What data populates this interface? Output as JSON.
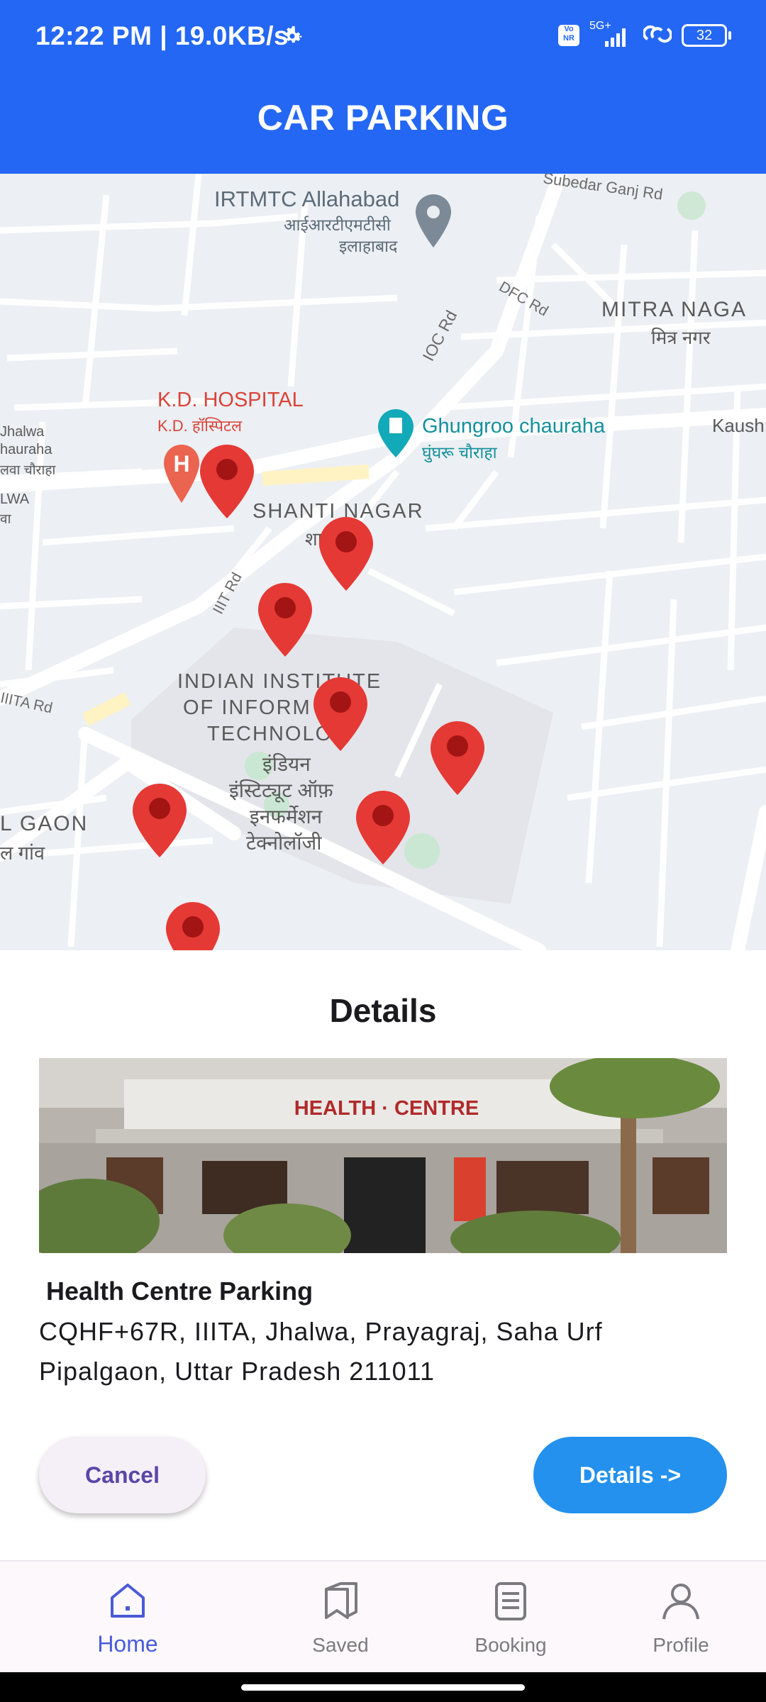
{
  "status_bar": {
    "time_speed": "12:22 PM | 19.0KB/s",
    "network": "5G+",
    "volte": "Vo NR",
    "battery": "32"
  },
  "app_bar": {
    "title": "CAR PARKING"
  },
  "map": {
    "labels": {
      "irtmtc_en": "IRTMTC Allahabad",
      "irtmtc_hi1": "आईआरटीएमटीसी",
      "irtmtc_hi2": "इलाहाबाद",
      "subedar": "Subedar Ganj Rd",
      "dfc": "DFC Rd",
      "ioc": "IOC Rd",
      "mitra_en": "MITRA NAGA",
      "mitra_hi": "मित्र नगर",
      "kaush": "Kaush",
      "kd_en": "K.D. HOSPITAL",
      "kd_hi": "K.D. हॉस्पिटल",
      "ghungroo_en": "Ghungroo chauraha",
      "ghungroo_hi": "घुंघरू चौराहा",
      "jhalwa1": "Jhalwa",
      "jhalwa2": "hauraha",
      "jhalwa3": "लवा चौराहा",
      "lwa1": "LWA",
      "lwa2": "वा",
      "shanti_en": "SHANTI NAGAR",
      "shanti_hi": "शा   गर",
      "iiit_rd": "IIIT Rd",
      "iiita_rd": "IIITA Rd",
      "inst1": "INDIAN INSTITUTE",
      "inst2": "OF INFORM    ON",
      "inst3": "TECHNOLO  Y",
      "inst_hi1": "इंडियन",
      "inst_hi2": "इंस्टिट्यूट ऑफ़",
      "inst_hi3": "इनफर्मेशन",
      "inst_hi4": "टेक्नोलॉजी",
      "gaon_en": "L GAON",
      "gaon_hi": "ल गांव"
    },
    "colors": {
      "marker": "#e53935",
      "marker_center": "#a31515",
      "road": "#ffffff"
    }
  },
  "details": {
    "title": "Details",
    "photo_sign": "HEALTH · CENTRE",
    "place_name": "Health Centre Parking",
    "address": "CQHF+67R, IIITA, Jhalwa, Prayagraj, Saha Urf Pipalgaon, Uttar Pradesh 211011",
    "cancel_label": "Cancel",
    "details_label": "Details ->"
  },
  "bottom_nav": {
    "items": [
      {
        "label": "Home",
        "icon": "home-icon",
        "active": true
      },
      {
        "label": "Saved",
        "icon": "saved-icon",
        "active": false
      },
      {
        "label": "Booking",
        "icon": "booking-icon",
        "active": false
      },
      {
        "label": "Profile",
        "icon": "profile-icon",
        "active": false
      }
    ],
    "active_color": "#4a5bd8"
  }
}
